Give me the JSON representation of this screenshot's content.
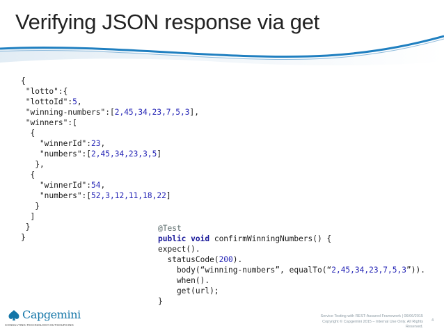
{
  "slide": {
    "title": "Verifying JSON response via get"
  },
  "json_lines": [
    [
      {
        "t": "{",
        "c": "s"
      }
    ],
    [
      {
        "t": " \"lotto\":{",
        "c": "s"
      }
    ],
    [
      {
        "t": " \"lottoId\":",
        "c": "s"
      },
      {
        "t": "5",
        "c": "n"
      },
      {
        "t": ",",
        "c": "s"
      }
    ],
    [
      {
        "t": " \"winning-numbers\":[",
        "c": "s"
      },
      {
        "t": "2,45,34,23,7,5,3",
        "c": "n"
      },
      {
        "t": "],",
        "c": "s"
      }
    ],
    [
      {
        "t": " \"winners\":[",
        "c": "s"
      }
    ],
    [
      {
        "t": "  {",
        "c": "s"
      }
    ],
    [
      {
        "t": "    \"winnerId\":",
        "c": "s"
      },
      {
        "t": "23",
        "c": "n"
      },
      {
        "t": ",",
        "c": "s"
      }
    ],
    [
      {
        "t": "    \"numbers\":[",
        "c": "s"
      },
      {
        "t": "2,45,34,23,3,5",
        "c": "n"
      },
      {
        "t": "]",
        "c": "s"
      }
    ],
    [
      {
        "t": "   },",
        "c": "s"
      }
    ],
    [
      {
        "t": "  {",
        "c": "s"
      }
    ],
    [
      {
        "t": "    \"winnerId\":",
        "c": "s"
      },
      {
        "t": "54",
        "c": "n"
      },
      {
        "t": ",",
        "c": "s"
      }
    ],
    [
      {
        "t": "    \"numbers\":[",
        "c": "s"
      },
      {
        "t": "52,3,12,11,18,22",
        "c": "n"
      },
      {
        "t": "]",
        "c": "s"
      }
    ],
    [
      {
        "t": "   }",
        "c": "s"
      }
    ],
    [
      {
        "t": "  ]",
        "c": "s"
      }
    ],
    [
      {
        "t": " }",
        "c": "s"
      }
    ],
    [
      {
        "t": "}",
        "c": "s"
      }
    ]
  ],
  "java_lines": [
    [
      {
        "t": "@Test",
        "c": "a"
      }
    ],
    [
      {
        "t": "public void",
        "c": "k"
      },
      {
        "t": " confirmWinningNumbers() {",
        "c": "s"
      }
    ],
    [
      {
        "t": "expect().",
        "c": "s"
      }
    ],
    [
      {
        "t": "  statusCode(",
        "c": "s"
      },
      {
        "t": "200",
        "c": "n"
      },
      {
        "t": ").",
        "c": "s"
      }
    ],
    [
      {
        "t": "    body(“winning-numbers”, equalTo(“",
        "c": "s"
      },
      {
        "t": "2,45,34,23,7,5,3",
        "c": "n"
      },
      {
        "t": "”)).",
        "c": "s"
      }
    ],
    [
      {
        "t": "    when().",
        "c": "s"
      }
    ],
    [
      {
        "t": "    get(url);",
        "c": "s"
      }
    ],
    [
      {
        "t": "}",
        "c": "s"
      }
    ]
  ],
  "logo": {
    "name": "Capgemini",
    "tagline": "CONSULTING.TECHNOLOGY.OUTSOURCING"
  },
  "footer": {
    "line1": "Service Testing with REST-Assured Framework | 06/06/2015",
    "line2": "Copyright © Capgemini 2015 – Internal Use Only. All Rights",
    "line3": "Reserved.",
    "page_number": "4"
  },
  "colors": {
    "wave": "#1f7fc0",
    "keyword": "#1a1a9a",
    "number": "#2323b5",
    "annotation": "#5a6a6a",
    "brand": "#1476a8"
  }
}
